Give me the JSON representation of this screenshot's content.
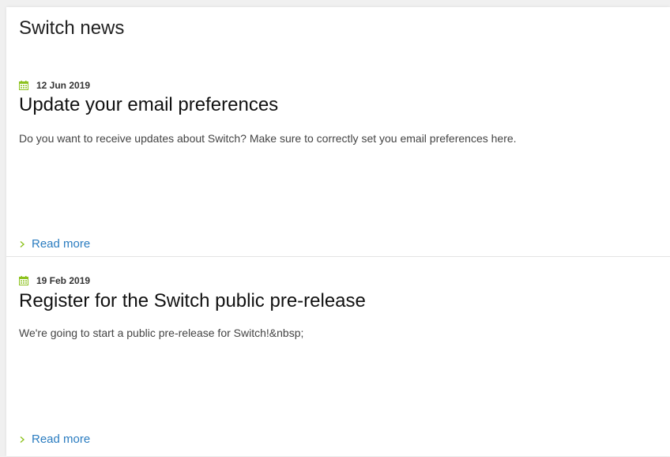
{
  "news": {
    "title": "Switch news",
    "articles": [
      {
        "date": "12 Jun 2019",
        "title": "Update your email preferences",
        "summary": "Do you want to receive updates about Switch? Make sure to correctly set you email preferences here.",
        "read_more": "Read more"
      },
      {
        "date": "19 Feb 2019",
        "title": "Register for the Switch public pre-release",
        "summary": "We're going to start a public pre-release for Switch!&nbsp;",
        "read_more": "Read more"
      }
    ]
  },
  "icons": {
    "date": "calendar-icon",
    "read_more": "chevron-right-icon"
  },
  "colors": {
    "accent_green": "#8dc21f",
    "link_blue": "#2a7cc0",
    "divider": "#e3e3e3"
  }
}
